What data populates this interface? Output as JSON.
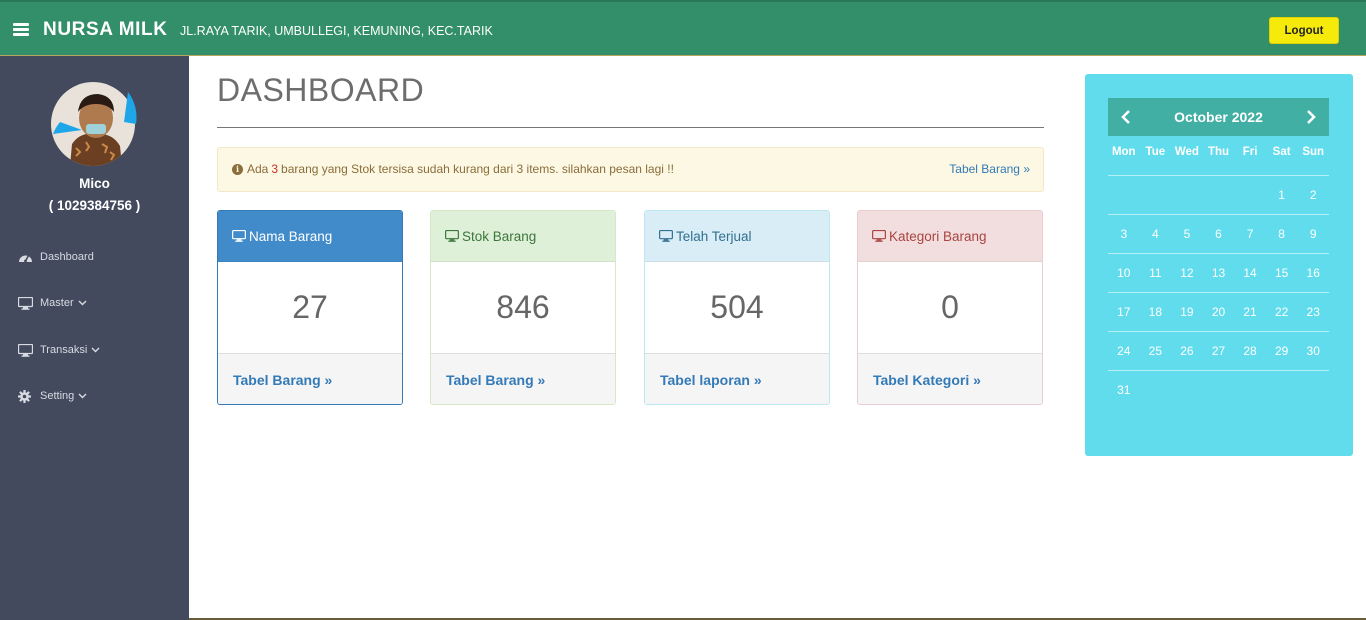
{
  "header": {
    "brand": "NURSA MILK",
    "address": "JL.RAYA TARIK, UMBULLEGI, KEMUNING, KEC.TARIK",
    "logout_label": "Logout",
    "menu_icon": "hamburger-icon"
  },
  "sidebar": {
    "user_name": "Mico",
    "user_id": "( 1029384756 )",
    "items": [
      {
        "label": "Dashboard",
        "icon": "dashboard-icon",
        "dropdown": false
      },
      {
        "label": "Master",
        "icon": "monitor-icon",
        "dropdown": true
      },
      {
        "label": "Transaksi",
        "icon": "monitor-icon",
        "dropdown": true
      },
      {
        "label": "Setting",
        "icon": "gear-icon",
        "dropdown": true
      }
    ]
  },
  "main": {
    "title": "DASHBOARD",
    "alert": {
      "prefix": "Ada",
      "count": "3",
      "message": "barang yang Stok tersisa sudah kurang dari 3 items. silahkan pesan lagi !!",
      "link": "Tabel Barang »"
    },
    "cards": [
      {
        "title": "Nama Barang",
        "value": "27",
        "link": "Tabel Barang »",
        "color": "#428bca"
      },
      {
        "title": "Stok Barang",
        "value": "846",
        "link": "Tabel Barang »",
        "color": "#dff0d8"
      },
      {
        "title": "Telah Terjual",
        "value": "504",
        "link": "Tabel laporan »",
        "color": "#d9edf7"
      },
      {
        "title": "Kategori Barang",
        "value": "0",
        "link": "Tabel Kategori »",
        "color": "#f2dede"
      }
    ]
  },
  "calendar": {
    "month_label": "October 2022",
    "weekdays": [
      "Mon",
      "Tue",
      "Wed",
      "Thu",
      "Fri",
      "Sat",
      "Sun"
    ],
    "weeks": [
      [
        "",
        "",
        "",
        "",
        "",
        "1",
        "2"
      ],
      [
        "3",
        "4",
        "5",
        "6",
        "7",
        "8",
        "9"
      ],
      [
        "10",
        "11",
        "12",
        "13",
        "14",
        "15",
        "16"
      ],
      [
        "17",
        "18",
        "19",
        "20",
        "21",
        "22",
        "23"
      ],
      [
        "24",
        "25",
        "26",
        "27",
        "28",
        "29",
        "30"
      ],
      [
        "31",
        "",
        "",
        "",
        "",
        "",
        ""
      ]
    ],
    "panel_color": "#61dced",
    "header_color": "#42afa4"
  },
  "colors": {
    "topbar": "#338f69",
    "sidebar": "#434a5e",
    "logout": "#f6ea0b"
  }
}
